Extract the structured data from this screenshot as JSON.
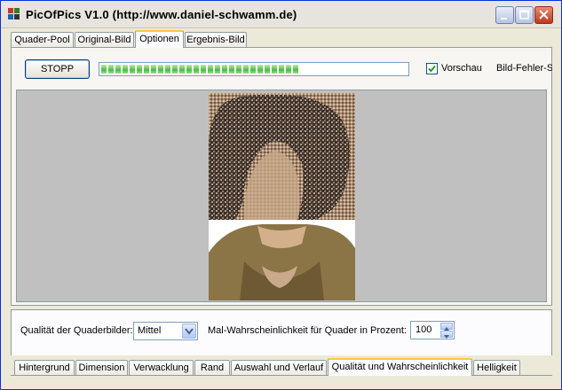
{
  "window": {
    "title": "PicOfPics V1.0 (http://www.daniel-schwamm.de)",
    "icons": {
      "app": "app-grid-icon",
      "minimize": "minimize-icon",
      "maximize": "maximize-icon",
      "close": "close-icon"
    }
  },
  "top_tabs": [
    {
      "label": "Quader-Pool"
    },
    {
      "label": "Original-Bild"
    },
    {
      "label": "Optionen",
      "active": true
    },
    {
      "label": "Ergebnis-Bild"
    }
  ],
  "toolbar": {
    "stop_label": "STOPP",
    "progress_fraction": 0.64,
    "preview_label": "Vorschau",
    "preview_checked": true,
    "error_label": "Bild-Fehler-S"
  },
  "quality": {
    "label": "Qualität der Quaderbilder:",
    "value": "Mittel"
  },
  "probability": {
    "label": "Mal-Wahrscheinlichkeit für Quader in Prozent:",
    "value": "100"
  },
  "bottom_tabs": [
    {
      "label": "Hintergrund"
    },
    {
      "label": "Dimension"
    },
    {
      "label": "Verwacklung"
    },
    {
      "label": "Rand"
    },
    {
      "label": "Auswahl und Verlauf"
    },
    {
      "label": "Qualität und Wahrscheinlichkeit",
      "active": true
    },
    {
      "label": "Helligkeit"
    }
  ],
  "colors": {
    "title_bar": "#e6e4dd",
    "panel": "#ece9d8",
    "progress": "#4dbb3e",
    "tab_highlight": "#ffc83c"
  }
}
